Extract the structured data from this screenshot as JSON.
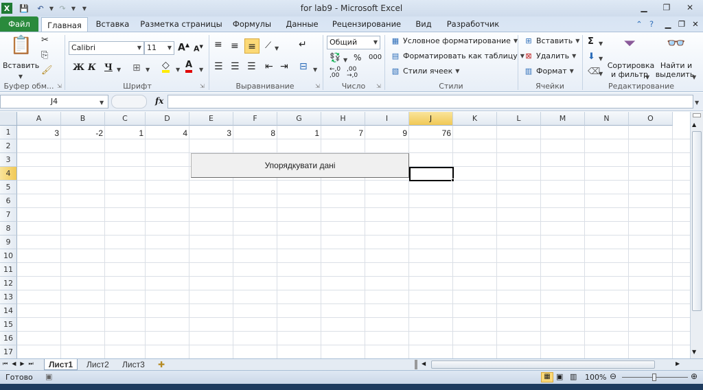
{
  "window": {
    "title": "for lab9  -  Microsoft Excel"
  },
  "tabs": [
    {
      "label": "Файл"
    },
    {
      "label": "Главная"
    },
    {
      "label": "Вставка"
    },
    {
      "label": "Разметка страницы"
    },
    {
      "label": "Формулы"
    },
    {
      "label": "Данные"
    },
    {
      "label": "Рецензирование"
    },
    {
      "label": "Вид"
    },
    {
      "label": "Разработчик"
    }
  ],
  "ribbon": {
    "clipboard": {
      "paste": "Вставить",
      "label": "Буфер обм..."
    },
    "font": {
      "name": "Calibri",
      "size": "11",
      "bold": "Ж",
      "italic": "К",
      "underline": "Ч",
      "label": "Шрифт"
    },
    "alignment": {
      "label": "Выравнивание"
    },
    "number": {
      "format": "Общий",
      "percent": "%",
      "thousands": "000",
      "label": "Число"
    },
    "styles": {
      "conditional": "Условное форматирование",
      "table": "Форматировать как таблицу",
      "cell_styles": "Стили ячеек",
      "label": "Стили"
    },
    "cells": {
      "insert": "Вставить",
      "delete": "Удалить",
      "format": "Формат",
      "label": "Ячейки"
    },
    "editing": {
      "sort": "Сортировка",
      "sort2": "и фильтр",
      "find": "Найти и",
      "find2": "выделить",
      "label": "Редактирование"
    }
  },
  "formula_bar": {
    "name_box": "J4",
    "fx": "fx",
    "value": ""
  },
  "columns": [
    "A",
    "B",
    "C",
    "D",
    "E",
    "F",
    "G",
    "H",
    "I",
    "J",
    "K",
    "L",
    "M",
    "N",
    "O"
  ],
  "rows": [
    "1",
    "2",
    "3",
    "4",
    "5",
    "6",
    "7",
    "8",
    "9",
    "10",
    "11",
    "12",
    "13",
    "14",
    "15",
    "16",
    "17"
  ],
  "row1_values": [
    "3",
    "-2",
    "1",
    "4",
    "3",
    "8",
    "1",
    "7",
    "9",
    "76"
  ],
  "button": {
    "label": "Упорядкувати дані"
  },
  "sheets": [
    "Лист1",
    "Лист2",
    "Лист3"
  ],
  "status": {
    "ready": "Готово",
    "zoom": "100%"
  }
}
